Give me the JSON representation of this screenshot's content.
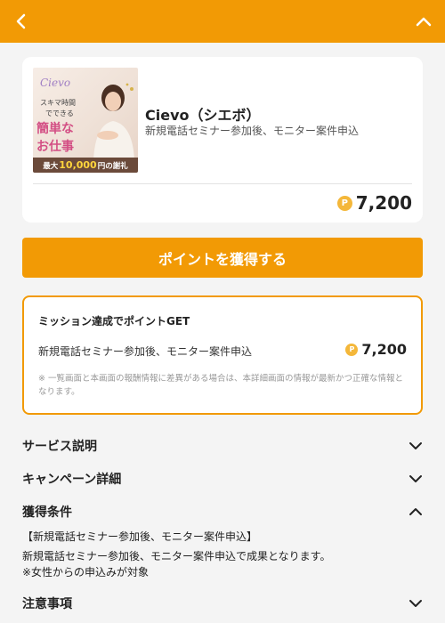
{
  "header": {
    "back_icon": "chevron-left-icon",
    "up_icon": "chevron-up-icon",
    "bg": "#f29a05"
  },
  "offer": {
    "thumbnail": {
      "brand": "Cievo",
      "line1": "スキマ時間",
      "line2": "でできる",
      "line3": "簡単な",
      "line4": "お仕事",
      "reward_prefix": "最大",
      "reward_amount": "10,000",
      "reward_suffix": "円の謝礼"
    },
    "title": "Cievo（シエボ）",
    "subtitle": "新規電話セミナー参加後、モニター案件申込",
    "point_icon": "P",
    "points": "7,200"
  },
  "cta": {
    "label": "ポイントを獲得する"
  },
  "mission": {
    "title": "ミッション達成でポイントGET",
    "task": "新規電話セミナー参加後、モニター案件申込",
    "points": "7,200",
    "note": "※ 一覧画面と本画面の報酬情報に差異がある場合は、本詳細画面の情報が最新かつ正確な情報となります。"
  },
  "sections": {
    "service": {
      "label": "サービス説明",
      "state": "collapsed"
    },
    "campaign": {
      "label": "キャンペーン詳細",
      "state": "collapsed"
    },
    "conditions": {
      "label": "獲得条件",
      "state": "expanded",
      "line1": "【新規電話セミナー参加後、モニター案件申込】",
      "line2": "新規電話セミナー参加後、モニター案件申込で成果となります。",
      "line3": "※女性からの申込みが対象"
    },
    "notes": {
      "label": "注意事項",
      "state": "collapsed"
    }
  }
}
